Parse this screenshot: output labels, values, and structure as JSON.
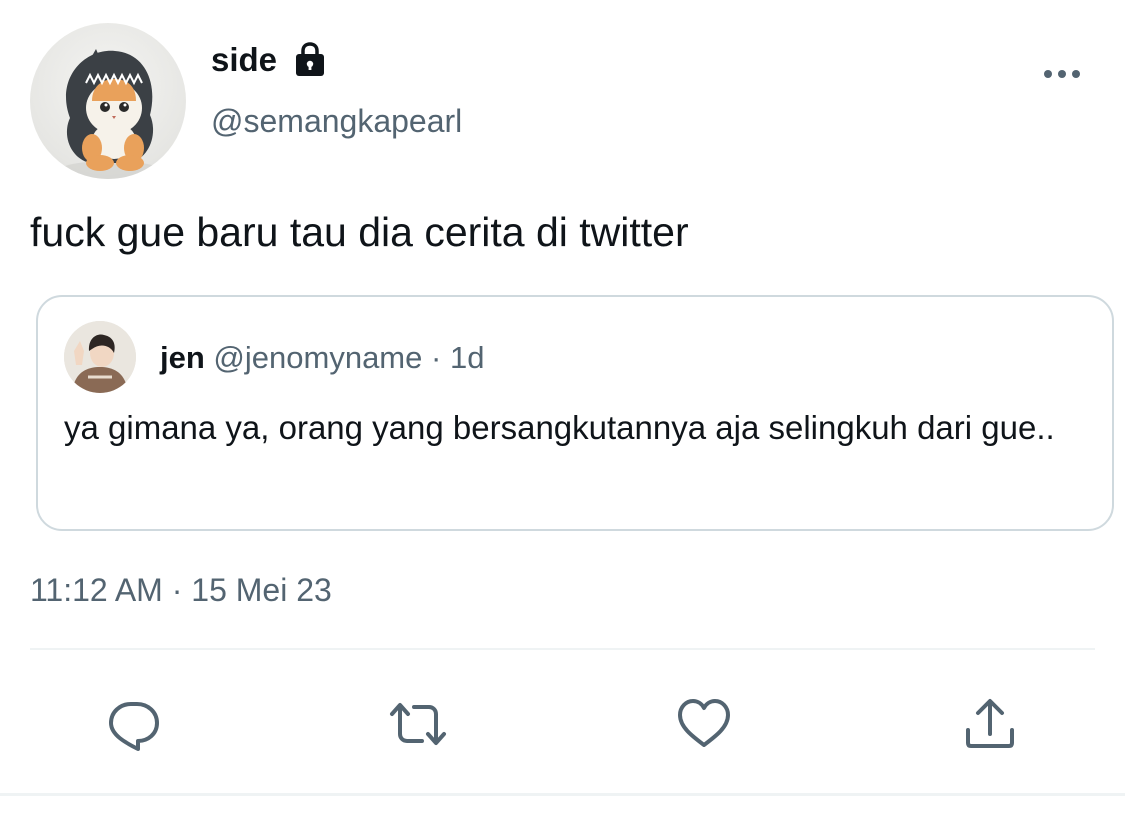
{
  "tweet": {
    "author": {
      "display_name": "side",
      "handle": "@semangkapearl",
      "avatar_icon": "plush-cat-shark-avatar",
      "locked": true
    },
    "text": "fuck gue baru tau dia cerita di twitter",
    "timestamp": "11:12 AM · 15 Mei 23"
  },
  "quote": {
    "display_name": "jen",
    "handle": "@jenomyname",
    "separator": "·",
    "time": "1d",
    "text": "ya gimana ya, orang yang bersangkutannya aja selingkuh dari gue.."
  },
  "actions": {
    "reply_icon": "reply-icon",
    "retweet_icon": "retweet-icon",
    "like_icon": "heart-icon",
    "share_icon": "share-icon"
  },
  "colors": {
    "text_primary": "#0f1419",
    "text_secondary": "#536471",
    "border": "#cfd9de"
  }
}
